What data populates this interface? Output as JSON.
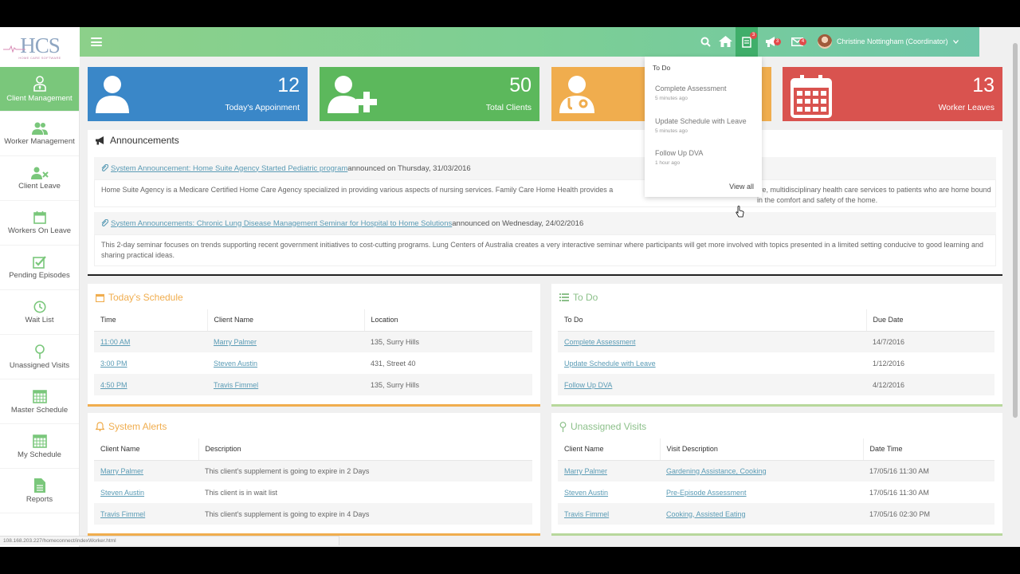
{
  "logo": {
    "text": "HCS",
    "subtitle": "HOME CARE SOFTWARE"
  },
  "topbar": {
    "badges": {
      "tasks": "3",
      "announcements": "3",
      "mail": "4"
    },
    "user_name": "Christine Nottingham (Coordinator)"
  },
  "sidebar": {
    "items": [
      {
        "label": "Client Management",
        "icon": "user-tie-icon"
      },
      {
        "label": "Worker Management",
        "icon": "users-icon"
      },
      {
        "label": "Client Leave",
        "icon": "user-x-icon"
      },
      {
        "label": "Workers On Leave",
        "icon": "calendar-icon"
      },
      {
        "label": "Pending Episodes",
        "icon": "check-square-icon"
      },
      {
        "label": "Wait List",
        "icon": "clock-icon"
      },
      {
        "label": "Unassigned Visits",
        "icon": "map-pin-icon"
      },
      {
        "label": "Master Schedule",
        "icon": "calendar-grid-icon"
      },
      {
        "label": "My Schedule",
        "icon": "calendar-grid-icon"
      },
      {
        "label": "Reports",
        "icon": "file-icon"
      }
    ]
  },
  "cards": [
    {
      "value": "12",
      "label": "Today's Appoinment",
      "color": "#3a87c8"
    },
    {
      "value": "50",
      "label": "Total Clients",
      "color": "#5cb85c"
    },
    {
      "value": "",
      "label": "",
      "color": "#f0ad4e"
    },
    {
      "value": "13",
      "label": "Worker Leaves",
      "color": "#d9534f"
    }
  ],
  "announcements": {
    "title": "Announcements",
    "items": [
      {
        "link": "System Announcement: Home Suite Agency Started Pediatric program",
        "meta": "announced on Thursday, 31/03/2016",
        "body": "Home Suite Agency is a Medicare Certified Home Care Agency specialized in providing various aspects of nursing services. Family Care Home Health provides a",
        "body_end": "ive, multidisciplinary health care services to patients who are home bound in the comfort and safety of the home."
      },
      {
        "link": "System Announcements: Chronic Lung Disease Management Seminar for Hospital to Home Solutions",
        "meta": "announced on Wednesday, 24/02/2016",
        "body": "This 2-day seminar focuses on trends supporting recent government initiatives to cost-cutting programs. Lung Centers of Australia creates a very interactive seminar where participants will get more involved with topics presented in a limited setting conducive to good learning and sharing practical ideas."
      }
    ]
  },
  "schedule": {
    "title": "Today's Schedule",
    "headers": [
      "Time",
      "Client Name",
      "Location"
    ],
    "rows": [
      [
        "11:00 AM",
        "Marry Palmer",
        "135, Surry Hills"
      ],
      [
        "3:00 PM",
        "Steven Austin",
        "431, Street 40"
      ],
      [
        "4:50 PM",
        "Travis Fimmel",
        "135, Surry Hills"
      ]
    ]
  },
  "todo": {
    "title": "To Do",
    "headers": [
      "To Do",
      "Due Date"
    ],
    "rows": [
      [
        "Complete Assessment",
        "14/7/2016"
      ],
      [
        "Update Schedule with Leave",
        "1/12/2016"
      ],
      [
        "Follow Up DVA",
        "4/12/2016"
      ]
    ]
  },
  "alerts": {
    "title": "System Alerts",
    "headers": [
      "Client Name",
      "Description"
    ],
    "rows": [
      [
        "Marry Palmer",
        "This client's supplement is going to expire in 2 Days"
      ],
      [
        "Steven Austin",
        "This client is in wait list"
      ],
      [
        "Travis Fimmel",
        "This client's supplement is going to expire in 4 Days"
      ]
    ]
  },
  "unassigned": {
    "title": "Unassigned Visits",
    "headers": [
      "Client Name",
      "Visit Description",
      "Date Time"
    ],
    "rows": [
      [
        "Marry Palmer",
        "Gardening Assistance, Cooking",
        "17/05/16 11:30 AM"
      ],
      [
        "Steven Austin",
        "Pre-Episode Assessment",
        "17/05/16 11:30 AM"
      ],
      [
        "Travis Fimmel",
        "Cooking, Assisted Eating",
        "17/05/16 02:30 PM"
      ]
    ]
  },
  "dropdown": {
    "title": "To Do",
    "items": [
      {
        "label": "Complete Assessment",
        "time": "5 minutes ago"
      },
      {
        "label": "Update Schedule with Leave",
        "time": "5 minutes ago"
      },
      {
        "label": "Follow Up DVA",
        "time": "1 hour ago"
      }
    ],
    "view_all": "View all"
  },
  "status_bar": "108.168.203.227/homeconnect/indexWorker.html"
}
